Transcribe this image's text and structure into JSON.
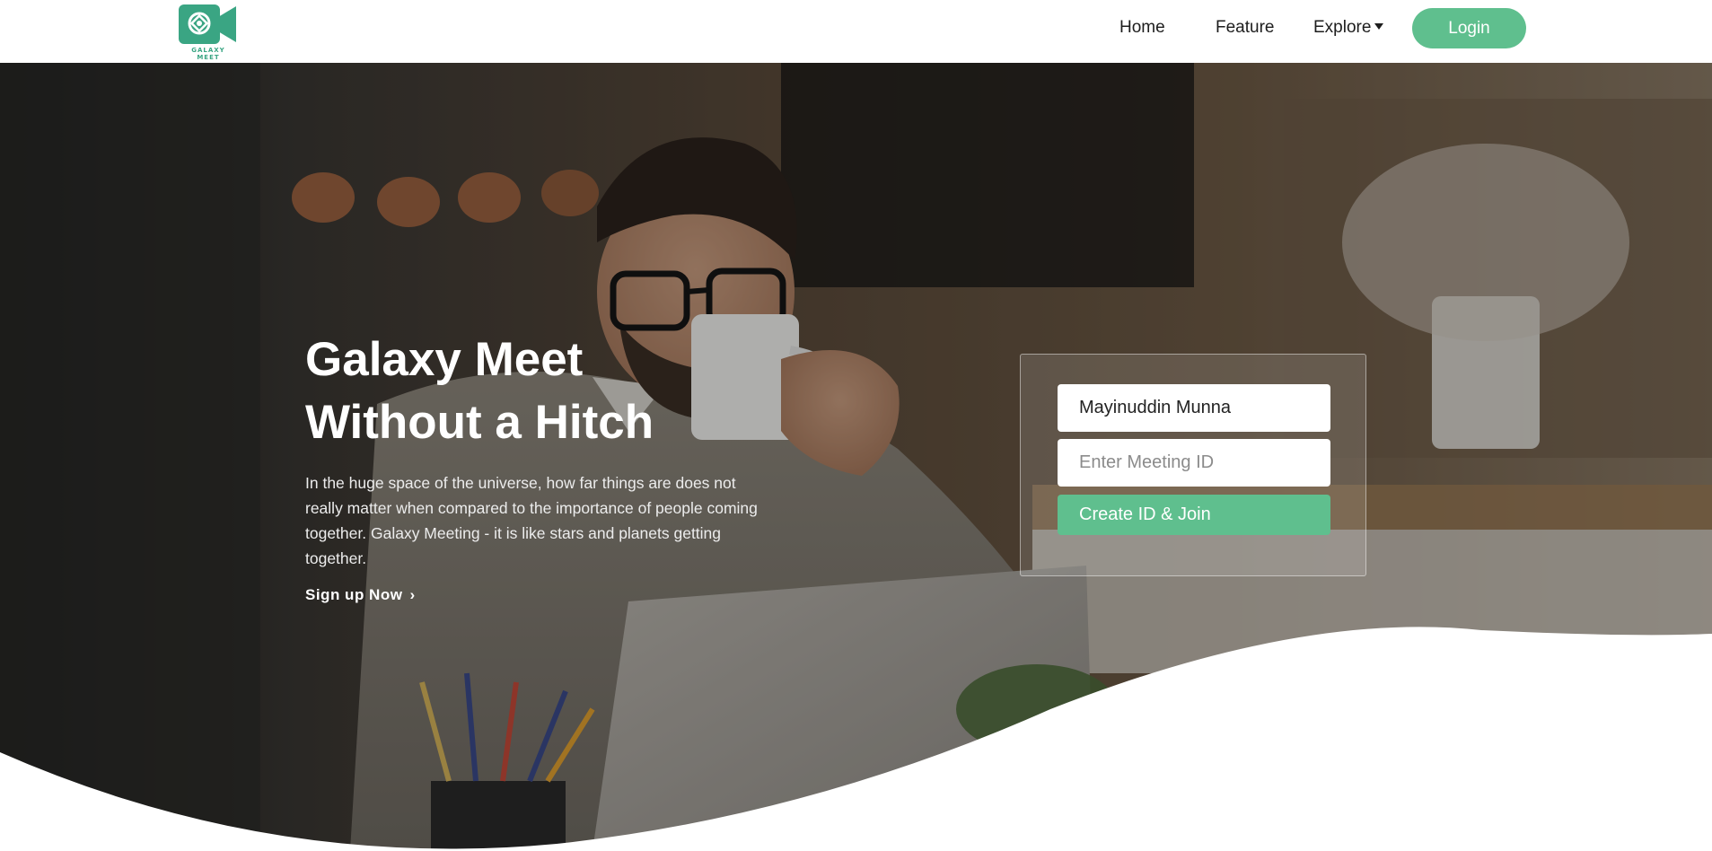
{
  "brand": {
    "logo_text": "GALAXY MEET",
    "accent_color": "#5fbf8e",
    "logo_color": "#3aa583"
  },
  "nav": {
    "home": "Home",
    "feature": "Feature",
    "explore": "Explore",
    "login": "Login"
  },
  "hero": {
    "title_line1": "Galaxy Meet",
    "title_line2": "Without a Hitch",
    "description": "In the huge space of the universe, how far things are does not really matter when compared to the importance of people coming together. Galaxy Meeting - it is like stars and planets getting together.",
    "signup_label": "Sign up Now"
  },
  "join_form": {
    "name_value": "Mayinuddin Munna",
    "meeting_id_placeholder": "Enter Meeting ID",
    "submit_label": "Create ID & Join"
  }
}
